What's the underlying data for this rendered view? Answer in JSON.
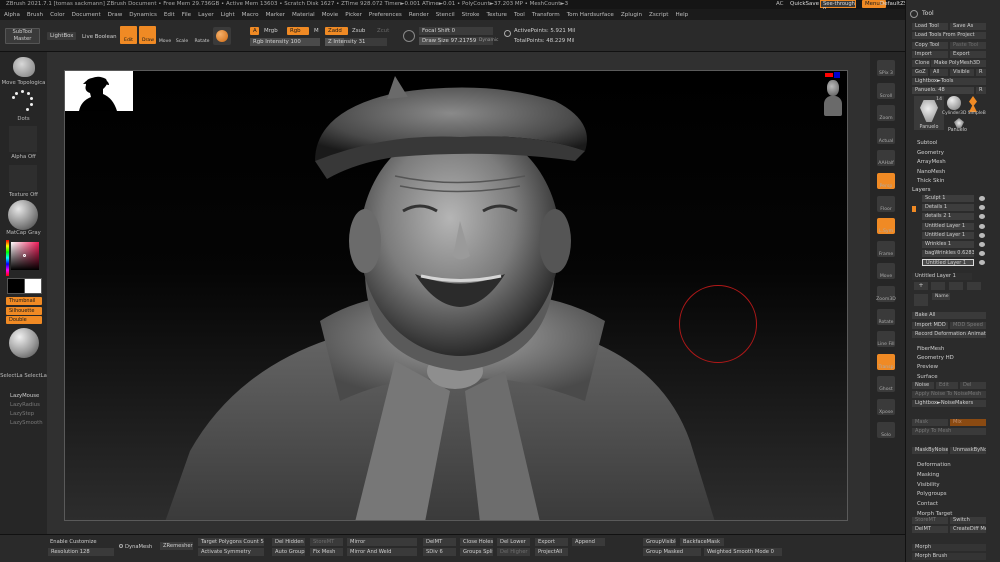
{
  "titlebar": "ZBrush 2021.7.1 [tomas sackmann]   ZBrush Document   • Free Mem 29.736GB • Active Mem 13603 • Scratch Disk 1627 • ZTime 928.072 Timer►0.001 ATime►0.01 • PolyCount►37.203 MP • MeshCount►3",
  "title_right": {
    "ac": "AC",
    "quicksave": "QuickSave",
    "seethrough": "See-through",
    "seethrough_value": "0",
    "menus": "Menus",
    "script": "DefaultZScript"
  },
  "menu": [
    "Alpha",
    "Brush",
    "Color",
    "Document",
    "Draw",
    "Dynamics",
    "Edit",
    "File",
    "Layer",
    "Light",
    "Macro",
    "Marker",
    "Material",
    "Movie",
    "Picker",
    "Preferences",
    "Render",
    "Stencil",
    "Stroke",
    "Texture",
    "Tool",
    "Transform",
    "Tom Hardsurface",
    "Zplugin",
    "Zscript",
    "Help"
  ],
  "topshelf": {
    "subtool_master": "SubTool Master",
    "lightbox": "LightBox",
    "live_boolean": "Live Boolean",
    "edit": "Edit",
    "draw": "Draw",
    "move": "Move",
    "scale": "Scale",
    "rotate": "Rotate",
    "a_label": "A",
    "mrgb": "Mrgb",
    "rgb": "Rgb",
    "m": "M",
    "zadd": "Zadd",
    "zsub": "Zsub",
    "zcut": "Zcut",
    "rgb_intensity": "Rgb Intensity 100",
    "z_intensity": "Z Intensity 31",
    "focal_shift": "Focal Shift 0",
    "draw_size": "Draw Size 97.21759",
    "dynamic": "Dynamic",
    "active_points": "ActivePoints: 5.921 Mil",
    "total_points": "TotalPoints: 48.229 Mil"
  },
  "lefttray": {
    "move_topological": "Move Topologica",
    "dots": "Dots",
    "alpha_off": "Alpha Off",
    "texture_off": "Texture Off",
    "matcap": "MatCap Gray",
    "thumbnail": "Thumbnail",
    "silhouette": "Silhouette",
    "double": "Double",
    "selectlasso": "SelectLa SelectLa",
    "lazymouse": "LazyMouse",
    "lazyradius": "LazyRadius",
    "lazystep": "LazyStep",
    "lazysmooth": "LazySmooth"
  },
  "rightstrip": [
    "SPix 3",
    "Scroll",
    "Zoom",
    "Actual",
    "AAHalf",
    "Persp",
    "Floor",
    "L.Sym",
    "Frame",
    "Move",
    "Zoom3D",
    "Rotate",
    "Line Fill",
    "Transp",
    "Ghost",
    "Xpose",
    "Solo"
  ],
  "toolpanel": {
    "title": "Tool",
    "load_tool": "Load Tool",
    "save_as": "Save As",
    "load_from_project": "Load Tools From Project",
    "copy_tool": "Copy Tool",
    "paste_tool": "Paste Tool",
    "import": "Import",
    "export": "Export",
    "clone": "Clone",
    "make_polymesh": "Make PolyMesh3D",
    "goz": "GoZ",
    "all": "All",
    "visible": "Visible",
    "r": "R",
    "lightbox_tools": "Lightbox►Tools",
    "panuelo_label": "Panuelo. 48",
    "r2": "R",
    "thumb_count": "14",
    "thumb_names": [
      "Panuelo",
      "Panuelo"
    ],
    "thumb_sphere": "Cylinder3D SimpleB",
    "sections": [
      "Subtool",
      "Geometry",
      "ArrayMesh",
      "NanoMesh",
      "Thick Skin"
    ],
    "layers_title": "Layers",
    "layers": [
      "Sculpt 1",
      "Details 1",
      "details 2 1",
      "Untitled Layer 1",
      "Untitled Layer 1",
      "Wrinkles 1",
      "bagWrinkles 0.62831",
      "Untitled Layer 1"
    ],
    "untitled_layer": "Untitled Layer 1",
    "name": "Name",
    "bake_all": "Bake All",
    "import_mdd": "Import MDD",
    "mdd_speed": "MDD Speed",
    "record_deformation": "Record Deformation Animation",
    "fibermesh": "FiberMesh",
    "geometry_hd": "Geometry HD",
    "preview": "Preview",
    "surface": "Surface",
    "noise": "Noise",
    "edit": "Edit",
    "del": "Del",
    "apply_noise": "Apply Noise To NoiseMesh",
    "lightbox_noisemakers": "Lightbox►NoiseMakers",
    "mask": "Mask",
    "mix": "Mix",
    "apply_to_mesh": "Apply To Mesh",
    "maskbynoise": "MaskByNoise",
    "unmaskbynoise": "UnmaskByNoise",
    "lower_sections": [
      "Deformation",
      "Masking",
      "Visibility",
      "Polygroups",
      "Contact",
      "Morph Target"
    ],
    "storemt": "StoreMT",
    "switch": "Switch",
    "delmt": "DelMT",
    "creatediff": "CreateDiff Mesh",
    "morph": "Morph",
    "morph_brush": "Morph Brush"
  },
  "bottomshelf": {
    "enable_customize": "Enable Customize",
    "resolution": "Resolution 128",
    "dynamesh": "DynaMesh",
    "zremesher": "ZRemesher",
    "target_polygons": "Target Polygons Count 5",
    "activate_symmetry": "Activate Symmetry",
    "del_hidden": "Del Hidden",
    "auto_groups": "Auto Groups",
    "storemt": "StoreMT",
    "fix_mesh": "Fix Mesh",
    "mirror": "Mirror",
    "mirror_weld": "Mirror And Weld",
    "delmt": "DelMT",
    "sdiv": "SDiv 6",
    "close_holes": "Close Holes",
    "groups_split": "Groups Split",
    "del_lower": "Del Lower",
    "del_higher": "Del Higher",
    "export": "Export",
    "project_all": "ProjectAll",
    "append": "Append",
    "groupvisible": "GroupVisible",
    "group_masked": "Group Masked",
    "backfacemask": "BackfaceMask",
    "weighted_smooth": "Weighted Smooth Mode 0"
  },
  "colors": {
    "accent": "#f08a24",
    "panel": "#2b2b2b",
    "viewport_bg": "#303030"
  },
  "icons": [
    "silhouette-thumbnail",
    "navigation-head-icon",
    "brush-sphere-icon",
    "dots-stroke-icon",
    "color-picker",
    "matcap-sphere",
    "move-topological-brush-icon"
  ]
}
